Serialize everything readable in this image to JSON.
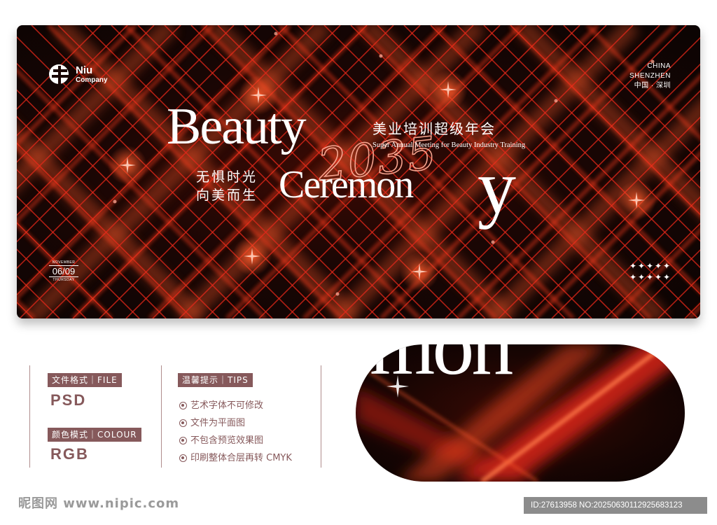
{
  "banner": {
    "logo": {
      "line1": "Niu",
      "line2": "Company"
    },
    "location": {
      "line1": "CHINA",
      "line2": "SHENZHEN",
      "line3": "中国 · 深圳"
    },
    "title": {
      "part1": "Beauty",
      "part2": "Ceremon",
      "part3": "y",
      "year": "2035"
    },
    "cn_title": "美业培训超级年会",
    "en_subtitle": "Super Annual Meeting for Beauty Industry Training",
    "slogan": {
      "line1": "无惧时光",
      "line2": "向美而生"
    },
    "date": {
      "month": "NOVEMBER",
      "day": "06/09",
      "weekday": "THURSDAY"
    },
    "colors": {
      "accent": "#e5281a",
      "glow": "#ff5a2a",
      "background": "#0b0403"
    }
  },
  "info": {
    "file_format": {
      "label": "文件格式｜FILE",
      "value": "PSD"
    },
    "color_mode": {
      "label": "颜色模式｜COLOUR",
      "value": "RGB"
    },
    "tips": {
      "label": "温馨提示｜TIPS",
      "items": [
        "艺术字体不可修改",
        "文件为平面图",
        "不包含预览效果图",
        "印刷整体合层再转 CMYK"
      ]
    },
    "colors": {
      "label_bg": "#86595b"
    }
  },
  "detail": {
    "text": "mon"
  },
  "footer": {
    "watermark_left": "昵图网 www.nipic.com",
    "watermark_right": "ID:27613958 NO:20250630112925683123"
  }
}
